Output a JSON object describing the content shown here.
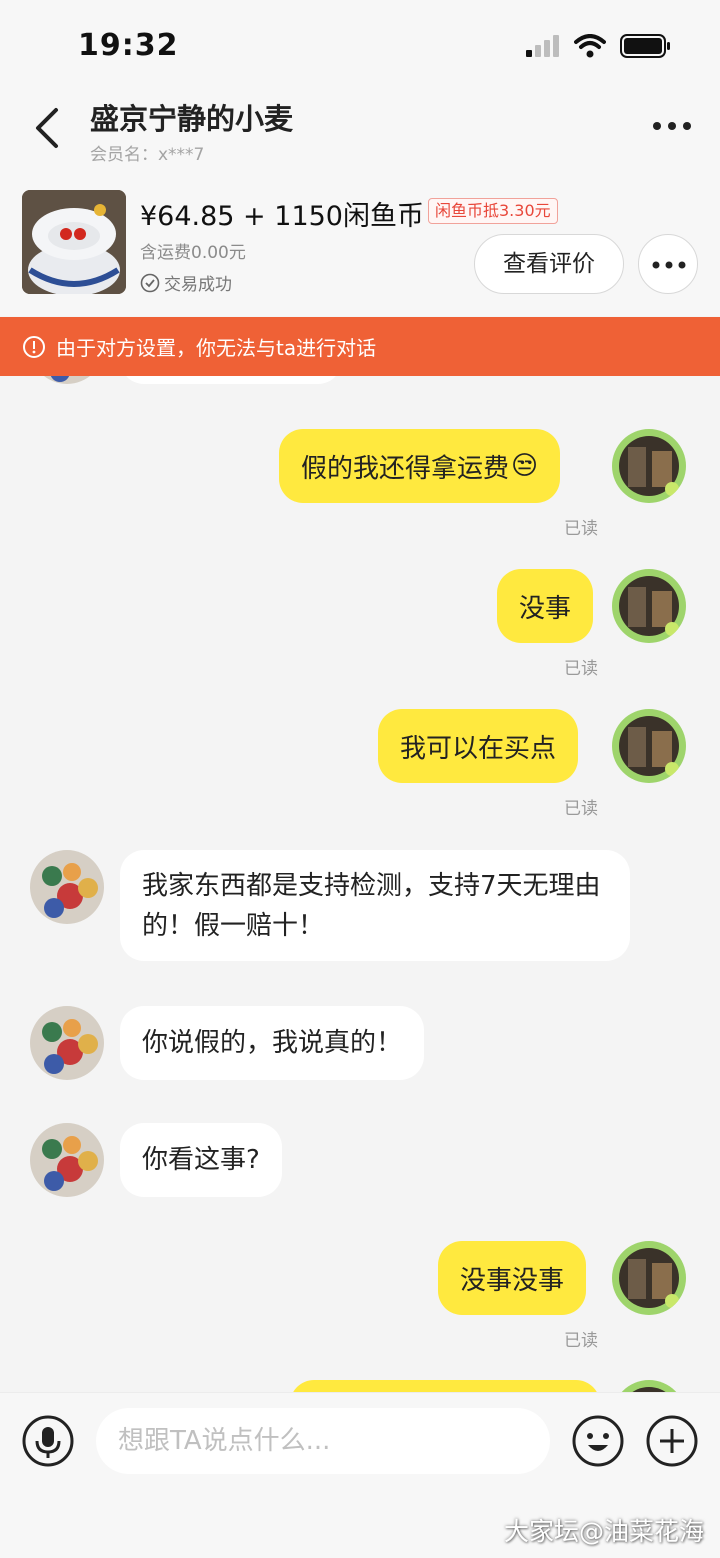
{
  "status_bar": {
    "time": "19:32",
    "icons": [
      "signal-icon",
      "wifi-icon",
      "battery-icon"
    ]
  },
  "header": {
    "contact_name": "盛京宁静的小麦",
    "member_label": "会员名：",
    "member_id": "x***7"
  },
  "product": {
    "price": "¥64.85 + 1150闲鱼币",
    "coin_badge": "闲鱼币抵3.30元",
    "shipping": "含运费0.00元",
    "status": "交易成功",
    "review_button": "查看评价"
  },
  "notice": {
    "text": "由于对方设置，你无法与ta进行对话"
  },
  "messages": [
    {
      "side": "mine",
      "text": "假的我还得拿运费",
      "emoji": "😒",
      "read": "已读"
    },
    {
      "side": "mine",
      "text": "没事",
      "read": "已读"
    },
    {
      "side": "mine",
      "text": "我可以在买点",
      "read": "已读"
    },
    {
      "side": "theirs",
      "text": "我家东西都是支持检测，支持7天无理由的！假一赔十！"
    },
    {
      "side": "theirs",
      "text": "你说假的，我说真的！"
    },
    {
      "side": "theirs",
      "text": "你看这事?"
    },
    {
      "side": "mine",
      "text": "没事没事",
      "read": "已读"
    }
  ],
  "input": {
    "placeholder": "想跟TA说点什么..."
  },
  "watermark": "大家坛@油菜花海",
  "colors": {
    "accent_yellow": "#ffe93f",
    "notice_orange": "#ef6136",
    "badge_red": "#e8473a"
  }
}
